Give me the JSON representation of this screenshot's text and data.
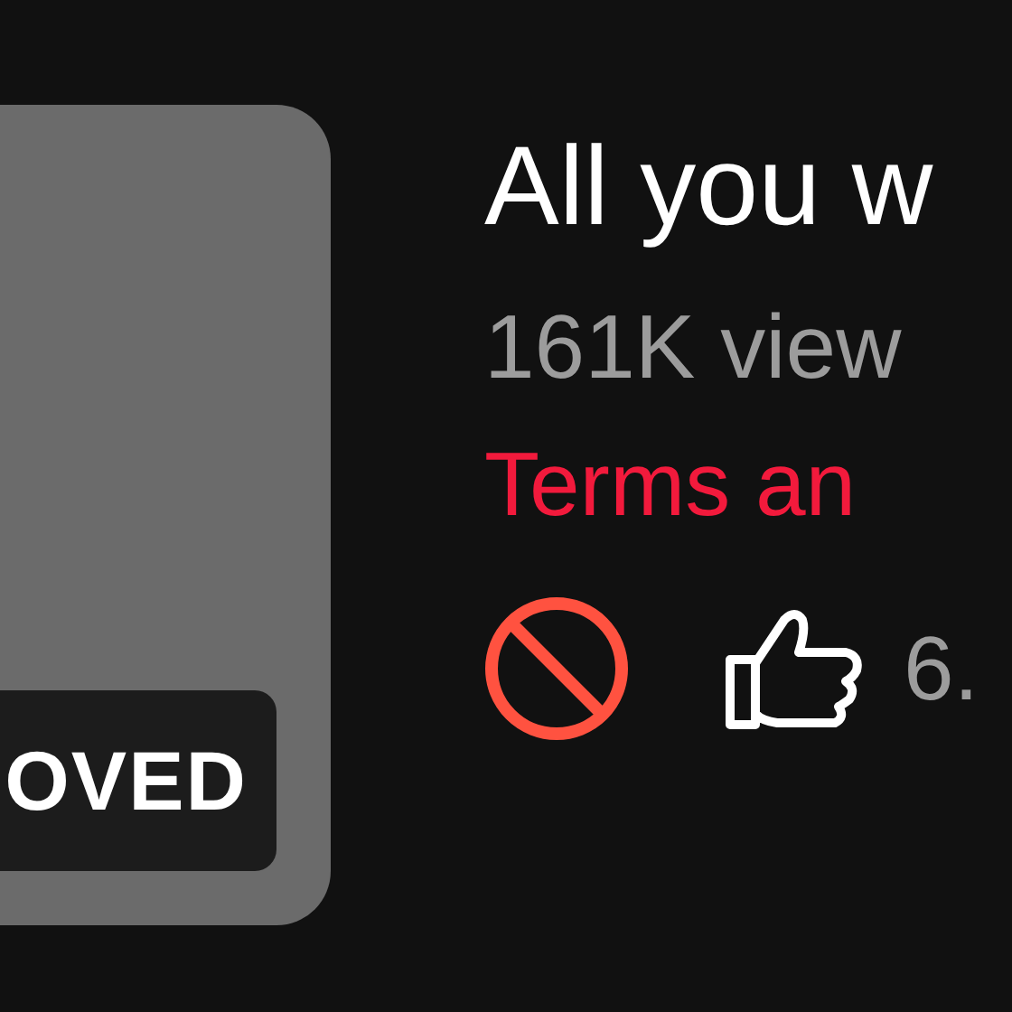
{
  "card": {
    "kind": "picture",
    "badge": "OVED"
  },
  "title": "All you w",
  "views": "161K view",
  "notice": "Terms an",
  "actions": {
    "blocked": true,
    "likes": "6."
  }
}
